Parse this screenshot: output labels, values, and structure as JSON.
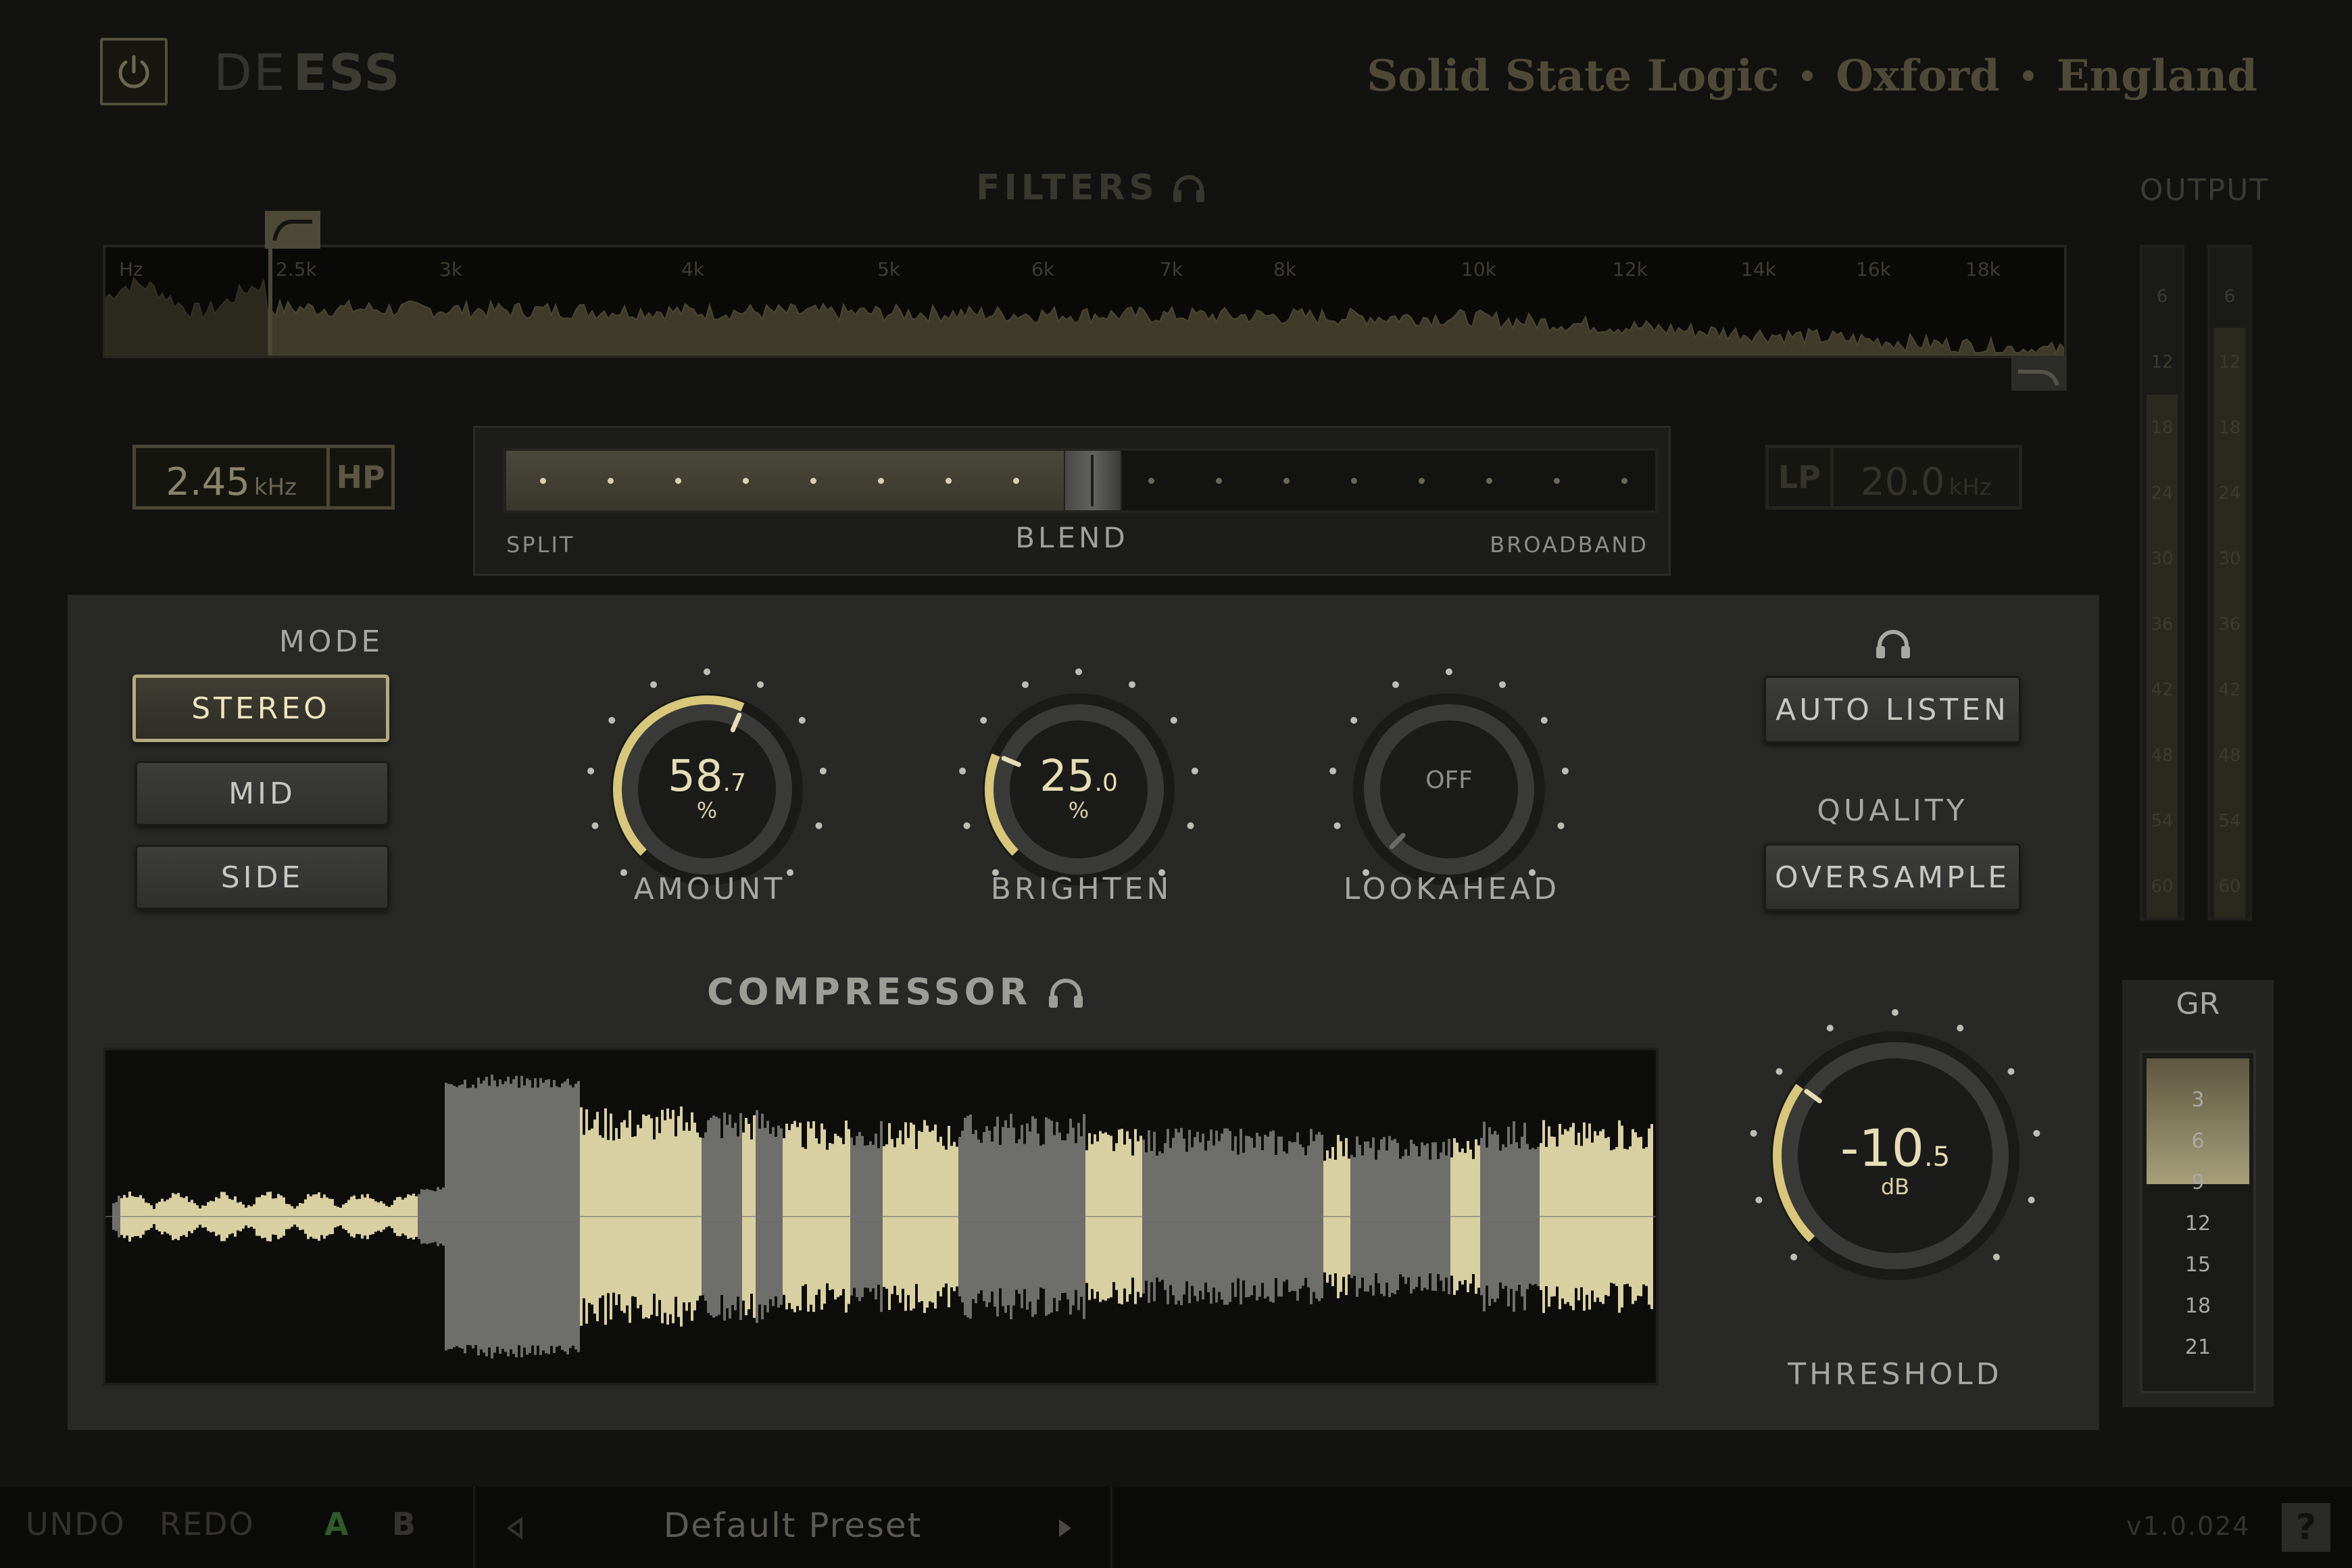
{
  "header": {
    "product_name_light": "DE",
    "product_name_bold": "ESS",
    "brand_words": [
      "Solid State Logic",
      "Oxford",
      "England"
    ]
  },
  "filters": {
    "title": "FILTERS",
    "freq_labels": [
      "Hz",
      "2.5k",
      "3k",
      "4k",
      "5k",
      "6k",
      "7k",
      "8k",
      "10k",
      "12k",
      "14k",
      "16k",
      "18k"
    ],
    "hp": {
      "value": "2.45",
      "unit": "kHz",
      "label": "HP"
    },
    "lp": {
      "value": "20.0",
      "unit": "kHz",
      "label": "LP"
    }
  },
  "blend": {
    "title": "BLEND",
    "left_label": "SPLIT",
    "right_label": "BROADBAND",
    "position": 0.45
  },
  "output": {
    "title": "OUTPUT",
    "ticks": [
      "6",
      "12",
      "18",
      "24",
      "30",
      "36",
      "42",
      "48",
      "54",
      "60"
    ],
    "left_level": 0.78,
    "right_level": 0.88
  },
  "mode": {
    "title": "MODE",
    "options": [
      "STEREO",
      "MID",
      "SIDE"
    ],
    "selected": "STEREO"
  },
  "knobs": {
    "amount": {
      "label": "AMOUNT",
      "value_int": "58",
      "value_frac": ".7",
      "unit": "%",
      "level": 0.587
    },
    "brighten": {
      "label": "BRIGHTEN",
      "value_int": "25",
      "value_frac": ".0",
      "unit": "%",
      "level": 0.25
    },
    "lookahead": {
      "label": "LOOKAHEAD",
      "value": "OFF"
    },
    "threshold": {
      "label": "THRESHOLD",
      "value_int": "-10",
      "value_frac": ".5",
      "unit": "dB",
      "level": 0.3
    }
  },
  "listen": {
    "auto_listen": "AUTO LISTEN",
    "quality_title": "QUALITY",
    "oversample": "OVERSAMPLE"
  },
  "compressor": {
    "title": "COMPRESSOR"
  },
  "gr": {
    "title": "GR",
    "ticks": [
      "3",
      "6",
      "9",
      "12",
      "15",
      "18",
      "21"
    ]
  },
  "footer": {
    "undo": "UNDO",
    "redo": "REDO",
    "a": "A",
    "b": "B",
    "preset": "Default Preset",
    "version": "v1.0.024",
    "help": "?"
  },
  "colors": {
    "accent": "#d8c77a",
    "accent_soft": "#e6ddb5",
    "panel": "#282827",
    "background": "#121211"
  }
}
